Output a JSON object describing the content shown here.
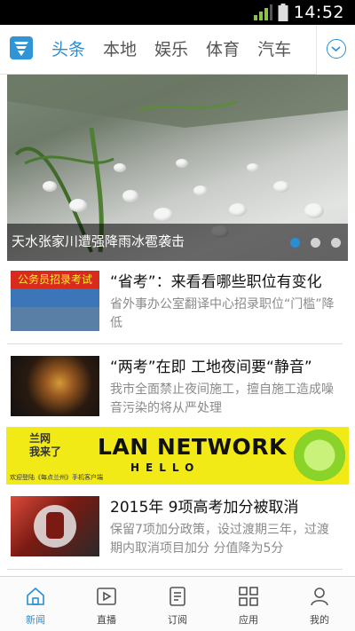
{
  "status_bar": {
    "time": "14:52"
  },
  "top_nav": {
    "tabs": [
      {
        "label": "头条",
        "active": true
      },
      {
        "label": "本地",
        "active": false
      },
      {
        "label": "娱乐",
        "active": false
      },
      {
        "label": "体育",
        "active": false
      },
      {
        "label": "汽车",
        "active": false
      }
    ],
    "more_icon": "chevron-down-circle-icon",
    "accent_color": "#2a8ed4"
  },
  "banner": {
    "caption": "天水张家川遭强降雨冰雹袭击",
    "slides_total": 3,
    "active_slide": 1
  },
  "news": [
    {
      "thumb_text": "公务员招录考试",
      "title": "“省考”：来看看哪些职位有变化",
      "summary": "省外事办公室翻译中心招录职位“门槛”降低"
    },
    {
      "title": "“两考”在即 工地夜间要“静音”",
      "summary": "我市全面禁止夜间施工，擅自施工造成噪音污染的将从严处理"
    },
    {
      "title": "2015年 9项高考加分被取消",
      "summary": "保留7项加分政策，设过渡期三年，过渡期内取消项目加分 分值降为5分"
    }
  ],
  "ad": {
    "cn_line1": "兰网",
    "cn_line2": "我来了",
    "brand": "LAN NETWORK",
    "tagline": "HELLO",
    "footnote": "欢迎登陆《每点兰州》手机客户端"
  },
  "tab_bar": [
    {
      "label": "新闻",
      "icon": "home-icon",
      "active": true
    },
    {
      "label": "直播",
      "icon": "play-icon",
      "active": false
    },
    {
      "label": "订阅",
      "icon": "document-icon",
      "active": false
    },
    {
      "label": "应用",
      "icon": "grid-icon",
      "active": false
    },
    {
      "label": "我的",
      "icon": "user-icon",
      "active": false
    }
  ]
}
